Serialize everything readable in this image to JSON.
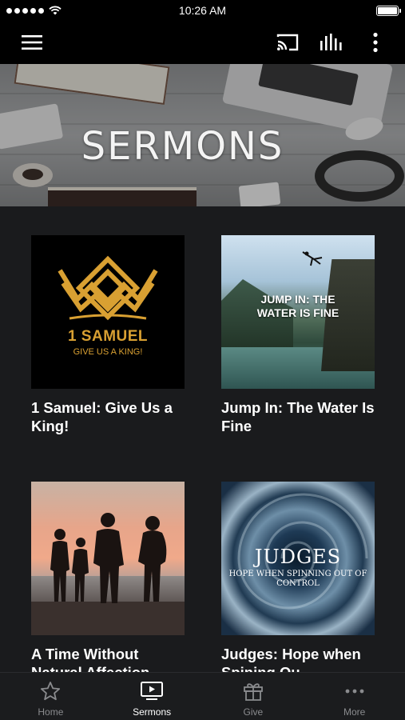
{
  "status_bar": {
    "time": "10:26 AM"
  },
  "app_bar": {
    "icons": [
      "menu-icon",
      "cast-icon",
      "equalizer-icon",
      "more-vertical-icon"
    ]
  },
  "hero": {
    "title": "SERMONS"
  },
  "sermons": [
    {
      "title": "1 Samuel: Give Us a King!",
      "thumb_title": "1 SAMUEL",
      "thumb_subtitle": "GIVE US A KING!"
    },
    {
      "title": "Jump In: The Water Is Fine",
      "thumb_text": "JUMP IN: THE WATER IS FINE"
    },
    {
      "title": "A Time Without Natural Affection"
    },
    {
      "title": "Judges: Hope when Spining Ou",
      "thumb_title": "JUDGES",
      "thumb_subtitle": "HOPE WHEN SPINNING OUT OF CONTROL"
    }
  ],
  "tabs": [
    {
      "label": "Home",
      "icon": "star-icon",
      "active": false
    },
    {
      "label": "Sermons",
      "icon": "tv-play-icon",
      "active": true
    },
    {
      "label": "Give",
      "icon": "gift-icon",
      "active": false
    },
    {
      "label": "More",
      "icon": "more-horizontal-icon",
      "active": false
    }
  ],
  "colors": {
    "background": "#1a1b1d",
    "accent_gold": "#d9a032",
    "tab_inactive": "#8a8b8e"
  }
}
